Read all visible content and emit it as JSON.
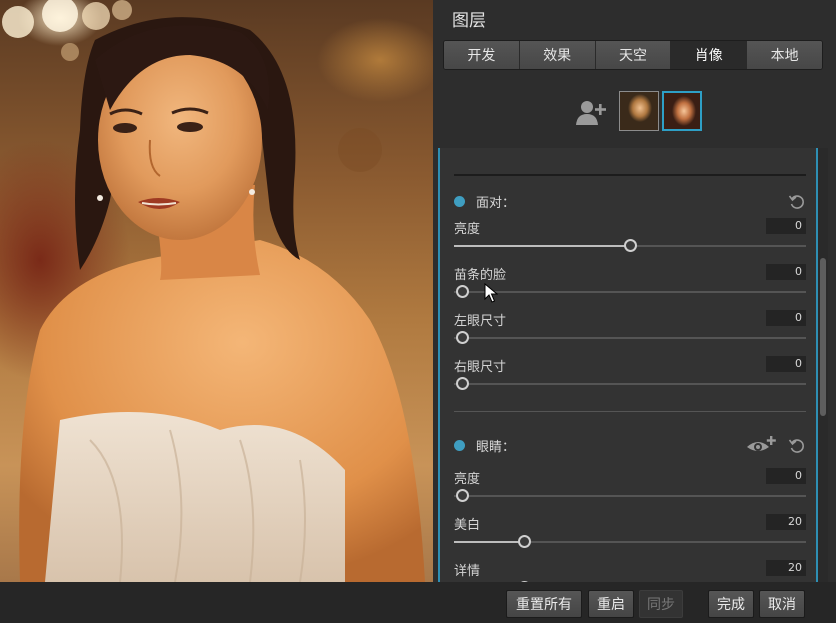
{
  "panel": {
    "title": "图层",
    "tabs": [
      {
        "label": "开发",
        "active": false
      },
      {
        "label": "效果",
        "active": false
      },
      {
        "label": "天空",
        "active": false
      },
      {
        "label": "肖像",
        "active": true
      },
      {
        "label": "本地",
        "active": false
      }
    ]
  },
  "faces": {
    "add_icon": "add-person-icon",
    "selected_index": 1
  },
  "face_section": {
    "label": "面对：",
    "sliders": [
      {
        "label": "亮度",
        "value": "0",
        "level": 0.5
      },
      {
        "label": "苗条的脸",
        "value": "0",
        "level": 0
      },
      {
        "label": "左眼尺寸",
        "value": "0",
        "level": 0
      },
      {
        "label": "右眼尺寸",
        "value": "0",
        "level": 0
      }
    ]
  },
  "eyes_section": {
    "label": "眼睛：",
    "sliders": [
      {
        "label": "亮度",
        "value": "0",
        "level": 0
      },
      {
        "label": "美白",
        "value": "20",
        "level": 0.2
      },
      {
        "label": "详情",
        "value": "20",
        "level": 0.2
      }
    ]
  },
  "bottom": {
    "reset_all": "重置所有",
    "restart": "重启",
    "sync": "同步",
    "done": "完成",
    "cancel": "取消"
  },
  "colors": {
    "accent": "#3f9ec1",
    "panel_bg": "#2d2d2d"
  }
}
